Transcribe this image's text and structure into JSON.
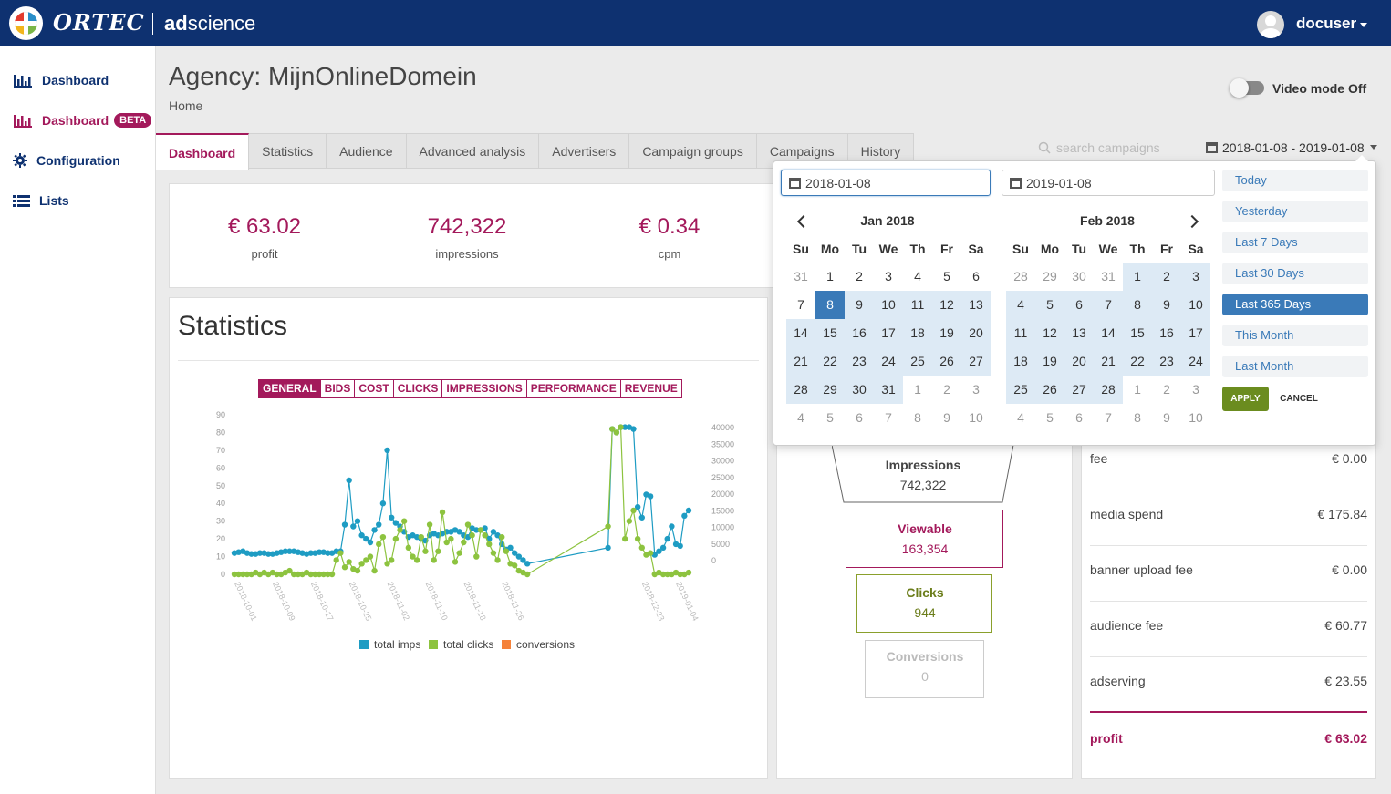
{
  "brand": {
    "name": "ORTEC",
    "product_prefix": "ad",
    "product_suffix": "science"
  },
  "user": {
    "name": "docuser"
  },
  "sidebar": {
    "items": [
      {
        "label": "Dashboard",
        "icon": "bar-chart-icon"
      },
      {
        "label": "Dashboard",
        "icon": "bar-chart-icon",
        "badge": "BETA"
      },
      {
        "label": "Configuration",
        "icon": "gear-icon"
      },
      {
        "label": "Lists",
        "icon": "list-icon"
      }
    ]
  },
  "header": {
    "title": "Agency: MijnOnlineDomein",
    "breadcrumb": "Home",
    "video_mode_label": "Video mode Off"
  },
  "tabs": [
    "Dashboard",
    "Statistics",
    "Audience",
    "Advanced analysis",
    "Advertisers",
    "Campaign groups",
    "Campaigns",
    "History"
  ],
  "search": {
    "placeholder": "search campaigns"
  },
  "date_range": {
    "label": "2018-01-08 - 2019-01-08"
  },
  "kpis": [
    {
      "value": "€ 63.02",
      "label": "profit"
    },
    {
      "value": "742,322",
      "label": "impressions"
    },
    {
      "value": "€ 0.34",
      "label": "cpm"
    }
  ],
  "statistics": {
    "title": "Statistics",
    "buttons": [
      "GENERAL",
      "BIDS",
      "COST",
      "CLICKS",
      "IMPRESSIONS",
      "PERFORMANCE",
      "REVENUE"
    ]
  },
  "chart_data": {
    "type": "line",
    "left_axis_ticks": [
      "90",
      "80",
      "70",
      "60",
      "50",
      "40",
      "30",
      "20",
      "10",
      "0"
    ],
    "right_axis_ticks": [
      "40000",
      "35000",
      "30000",
      "25000",
      "20000",
      "15000",
      "10000",
      "5000",
      "0"
    ],
    "ylim_left": [
      0,
      90
    ],
    "ylim_right": [
      0,
      40000
    ],
    "x_tick_labels": [
      "2018-10-01",
      "2018-10-09",
      "2018-10-17",
      "2018-10-25",
      "2018-11-02",
      "2018-11-10",
      "2018-11-18",
      "2018-11-26",
      "2018-12-23",
      "2019-01-04"
    ],
    "series": [
      {
        "name": "total imps",
        "color": "#1e9cc3",
        "x": [
          0,
          1,
          2,
          3,
          4,
          5,
          6,
          7,
          8,
          9,
          10,
          11,
          12,
          13,
          14,
          15,
          16,
          17,
          18,
          19,
          20,
          21,
          22,
          23,
          24,
          25,
          26,
          27,
          28,
          29,
          30,
          31,
          32,
          33,
          34,
          35,
          36,
          37,
          38,
          39,
          40,
          41,
          42,
          43,
          44,
          45,
          46,
          47,
          48,
          49,
          50,
          51,
          52,
          53,
          54,
          55,
          56,
          57,
          58,
          59,
          60,
          61,
          62,
          63,
          64,
          65,
          66,
          67,
          68,
          69,
          88,
          89,
          90,
          91,
          92,
          93,
          94,
          95,
          96,
          97,
          98,
          99,
          100,
          101,
          102,
          103,
          104,
          105,
          106,
          107
        ],
        "y": [
          12,
          12.5,
          13,
          12,
          11.5,
          11.5,
          12,
          12,
          11.5,
          11.5,
          12,
          12.5,
          13,
          13,
          13,
          12.5,
          12,
          11.5,
          12,
          12,
          12.5,
          12.5,
          12,
          12,
          13,
          13,
          28,
          53,
          27,
          30,
          22,
          20,
          18,
          25,
          28,
          40,
          70,
          32,
          29,
          27,
          24,
          21,
          22,
          21,
          20,
          19,
          22,
          23,
          22,
          23,
          24,
          24,
          25,
          24,
          22,
          21,
          26,
          25,
          25,
          26,
          20,
          24,
          22,
          17,
          14,
          15,
          12,
          10,
          8,
          6,
          15,
          82,
          80,
          83,
          83,
          83,
          82,
          38,
          32,
          45,
          44,
          11,
          13,
          15,
          20,
          27,
          17,
          16,
          33,
          36
        ],
        "scale": "right"
      },
      {
        "name": "total clicks",
        "color": "#8dc33f",
        "x": [
          0,
          1,
          2,
          3,
          4,
          5,
          6,
          7,
          8,
          9,
          10,
          11,
          12,
          13,
          14,
          15,
          16,
          17,
          18,
          19,
          20,
          21,
          22,
          23,
          24,
          25,
          26,
          27,
          28,
          29,
          30,
          31,
          32,
          33,
          34,
          35,
          36,
          37,
          38,
          39,
          40,
          41,
          42,
          43,
          44,
          45,
          46,
          47,
          48,
          49,
          50,
          51,
          52,
          53,
          54,
          55,
          56,
          57,
          58,
          59,
          60,
          61,
          62,
          63,
          64,
          65,
          66,
          67,
          68,
          69,
          88,
          89,
          90,
          91,
          92,
          93,
          94,
          95,
          96,
          97,
          98,
          99,
          100,
          101,
          102,
          103,
          104,
          105,
          106,
          107
        ],
        "y": [
          0,
          0,
          0,
          0,
          0,
          1,
          0,
          1,
          0,
          1,
          0,
          0,
          1,
          2,
          0,
          0,
          0,
          1,
          0,
          0,
          0,
          0,
          0,
          0,
          8,
          12,
          4,
          7,
          3,
          2,
          6,
          8,
          10,
          2,
          17,
          21,
          6,
          8,
          20,
          25,
          30,
          15,
          10,
          8,
          21,
          13,
          28,
          8,
          13,
          35,
          18,
          20,
          7,
          12,
          18,
          28,
          22,
          10,
          25,
          22,
          17,
          12,
          8,
          21,
          13,
          6,
          5,
          2,
          1,
          0,
          27,
          82,
          80,
          83,
          20,
          30,
          36,
          20,
          15,
          11,
          12,
          0,
          1,
          0,
          0,
          0,
          1,
          0,
          0,
          1
        ],
        "scale": "left"
      },
      {
        "name": "conversions",
        "color": "#f5823a",
        "x": [],
        "y": [],
        "scale": "left"
      }
    ]
  },
  "funnel": [
    {
      "label": "Impressions",
      "value": "742,322"
    },
    {
      "label": "Viewable",
      "value": "163,354"
    },
    {
      "label": "Clicks",
      "value": "944"
    },
    {
      "label": "Conversions",
      "value": "0"
    }
  ],
  "costs": [
    {
      "label": "fee",
      "value": "€ 0.00"
    },
    {
      "label": "media spend",
      "value": "€ 175.84"
    },
    {
      "label": "banner upload fee",
      "value": "€ 0.00"
    },
    {
      "label": "audience fee",
      "value": "€ 60.77"
    },
    {
      "label": "adserving",
      "value": "€ 23.55"
    }
  ],
  "profit_row": {
    "label": "profit",
    "value": "€ 63.02"
  },
  "datepicker": {
    "start_input": "2018-01-08",
    "end_input": "2019-01-08",
    "weekdays": [
      "Su",
      "Mo",
      "Tu",
      "We",
      "Th",
      "Fr",
      "Sa"
    ],
    "left_month": {
      "title": "Jan 2018",
      "weeks": [
        [
          "31",
          "1",
          "2",
          "3",
          "4",
          "5",
          "6"
        ],
        [
          "7",
          "8",
          "9",
          "10",
          "11",
          "12",
          "13"
        ],
        [
          "14",
          "15",
          "16",
          "17",
          "18",
          "19",
          "20"
        ],
        [
          "21",
          "22",
          "23",
          "24",
          "25",
          "26",
          "27"
        ],
        [
          "28",
          "29",
          "30",
          "31",
          "1",
          "2",
          "3"
        ],
        [
          "4",
          "5",
          "6",
          "7",
          "8",
          "9",
          "10"
        ]
      ]
    },
    "right_month": {
      "title": "Feb 2018",
      "weeks": [
        [
          "28",
          "29",
          "30",
          "31",
          "1",
          "2",
          "3"
        ],
        [
          "4",
          "5",
          "6",
          "7",
          "8",
          "9",
          "10"
        ],
        [
          "11",
          "12",
          "13",
          "14",
          "15",
          "16",
          "17"
        ],
        [
          "18",
          "19",
          "20",
          "21",
          "22",
          "23",
          "24"
        ],
        [
          "25",
          "26",
          "27",
          "28",
          "1",
          "2",
          "3"
        ],
        [
          "4",
          "5",
          "6",
          "7",
          "8",
          "9",
          "10"
        ]
      ]
    },
    "ranges": [
      "Today",
      "Yesterday",
      "Last 7 Days",
      "Last 30 Days",
      "Last 365 Days",
      "This Month",
      "Last Month"
    ],
    "active_range": "Last 365 Days",
    "apply_label": "APPLY",
    "cancel_label": "CANCEL"
  }
}
